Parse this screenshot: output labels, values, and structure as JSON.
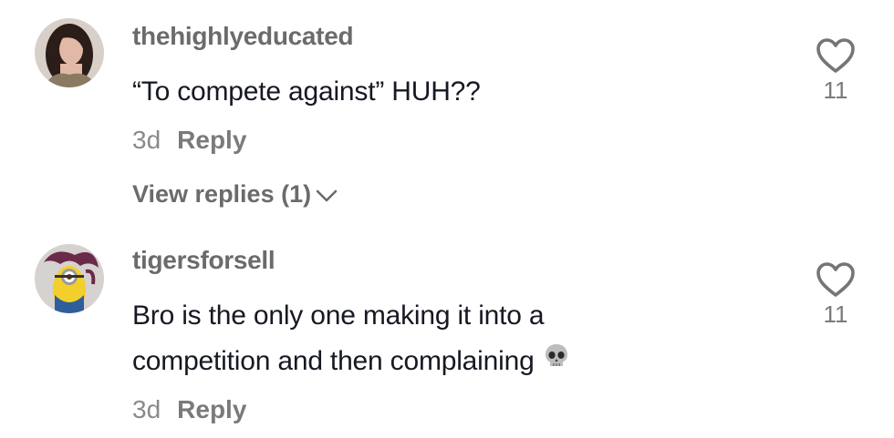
{
  "comments": [
    {
      "username": "thehighlyeducated",
      "text_lines": [
        "“To compete against” HUH??"
      ],
      "age": "3d",
      "reply_label": "Reply",
      "likes": "11",
      "view_replies": "View replies (1)"
    },
    {
      "username": "tigersforsell",
      "text_lines": [
        "Bro is the only one making it into a",
        "competition and then complaining"
      ],
      "emoji": "skull-emoji",
      "age": "3d",
      "reply_label": "Reply",
      "likes": "11"
    }
  ],
  "icons": {
    "like": "heart-outline-icon",
    "expand": "chevron-down-icon"
  },
  "colors": {
    "username": "#6b6b6b",
    "text": "#161823",
    "meta": "#8a8a8a"
  }
}
